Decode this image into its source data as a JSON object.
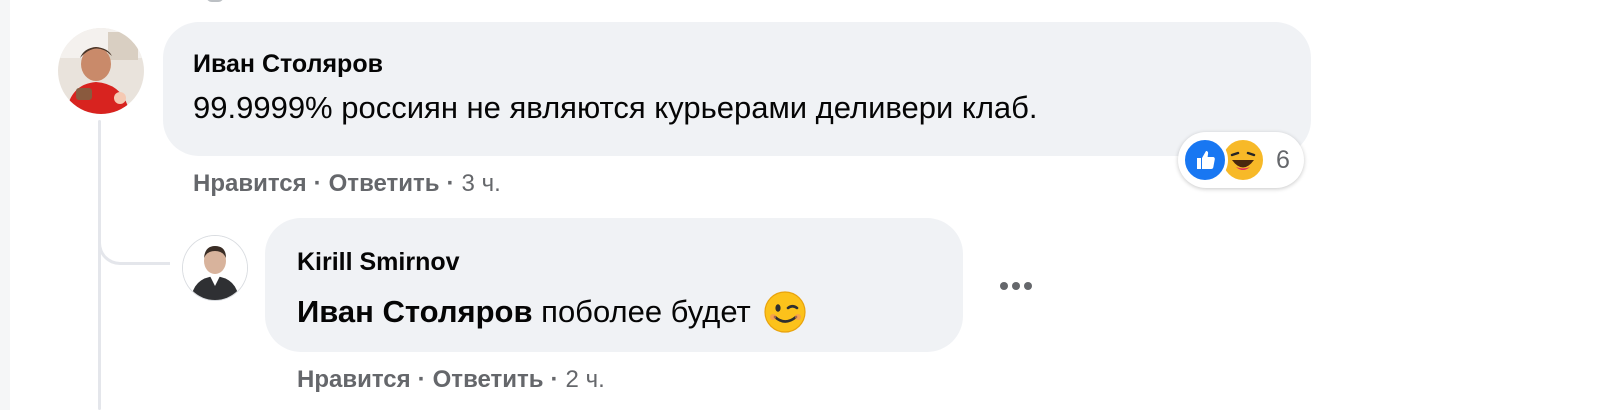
{
  "comment": {
    "author": "Иван Столяров",
    "text": "99.9999% россиян не являются курьерами деливери клаб.",
    "actions": {
      "like": "Нравится",
      "separator": "·",
      "reply": "Ответить",
      "time": "3 ч."
    },
    "reactions": {
      "icons": [
        "like-icon",
        "haha-icon"
      ],
      "count": "6"
    }
  },
  "reply": {
    "author": "Kirill Smirnov",
    "mention": "Иван Столяров",
    "text": " поболее будет",
    "emoji": "wink-emoji-icon",
    "actions": {
      "like": "Нравится",
      "separator": "·",
      "reply": "Ответить",
      "time": "2 ч."
    },
    "more_icon": "more-horizontal-icon"
  },
  "colors": {
    "bubble": "#f0f2f5",
    "meta_text": "#65676b",
    "like_blue": "#1877f2",
    "haha_yellow": "#f7b928",
    "thread_line": "#e4e6eb"
  }
}
